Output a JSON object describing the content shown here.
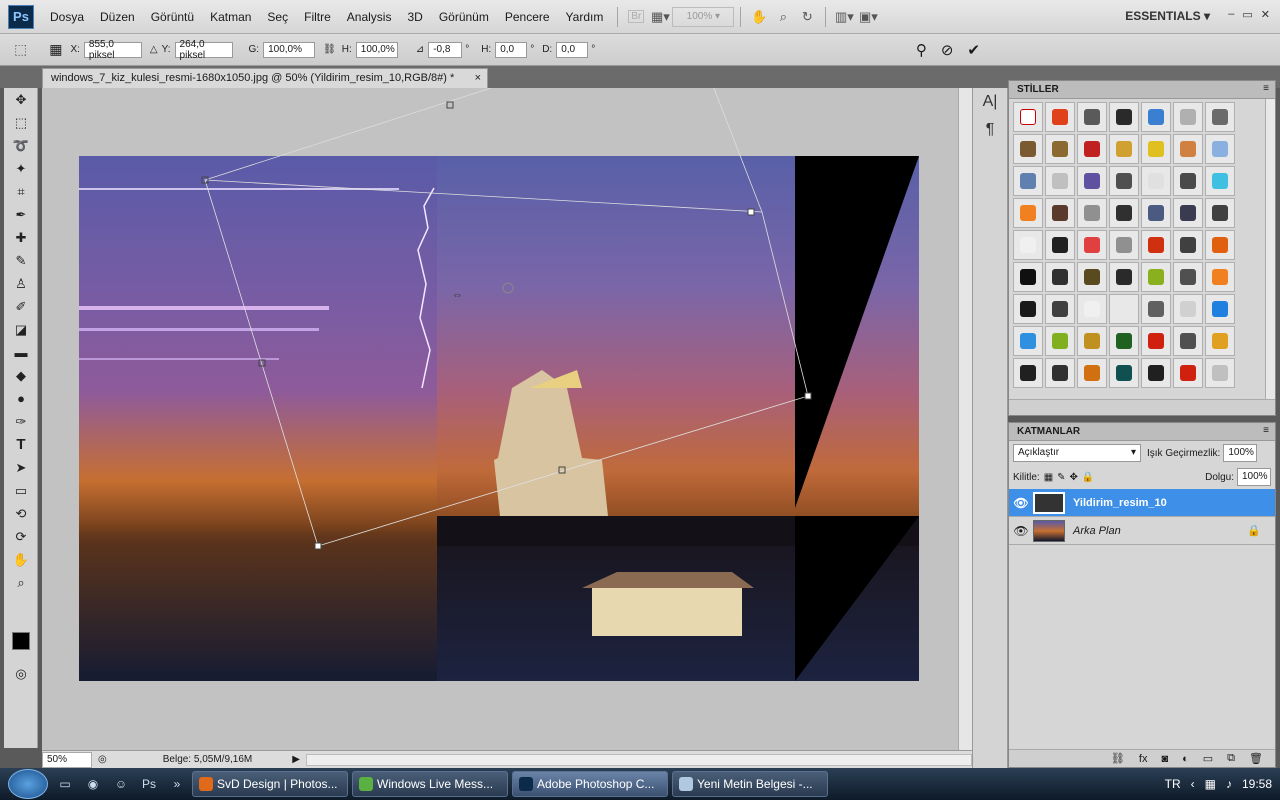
{
  "app": {
    "logo": "Ps",
    "menus": [
      "Dosya",
      "Düzen",
      "Görüntü",
      "Katman",
      "Seç",
      "Filtre",
      "Analysis",
      "3D",
      "Görünüm",
      "Pencere",
      "Yardım"
    ],
    "br_button": "Br",
    "zoom_level": "100%",
    "workspace": "ESSENTIALS",
    "window_controls": [
      "–",
      "▭",
      "✕"
    ]
  },
  "options": {
    "x_label": "X:",
    "x_value": "855,0 piksel",
    "y_label": "Y:",
    "y_value": "264,0 piksel",
    "w_label": "G:",
    "w_value": "100,0%",
    "h_label": "H:",
    "h_value": "100,0%",
    "angle_value": "-0,8",
    "degree": "°",
    "hskew_label": "H:",
    "hskew_value": "0,0",
    "vskew_label": "D:",
    "vskew_value": "0,0"
  },
  "document": {
    "tab_title": "windows_7_kiz_kulesi_resmi-1680x1050.jpg @ 50% (Yildirim_resim_10,RGB/8#) *",
    "close": "×"
  },
  "status": {
    "zoom": "50%",
    "doc_size": "Belge: 5,05M/9,16M"
  },
  "styles_panel": {
    "title": "STİLLER",
    "swatch_colors": [
      "#ffffff",
      "#e0401a",
      "#5a5a5a",
      "#2a2a2a",
      "#3a7fd0",
      "#b0b0b0",
      "#6a6a6a",
      "#7a5a30",
      "#8a6a30",
      "#c02020",
      "#d0a030",
      "#e0c020",
      "#d08040",
      "#8ab0e0",
      "#6080b0",
      "#c0c0c0",
      "#6050a0",
      "#505050",
      "#e0e0e0",
      "#4a4a4a",
      "#40c0e0",
      "#f08020",
      "#5a3a2a",
      "#909090",
      "#303030",
      "#4a5a80",
      "#3a3a50",
      "#404040",
      "#f0f0f0",
      "#202020",
      "#e04040",
      "#909090",
      "#d03010",
      "#404040",
      "#e06010",
      "#101010",
      "#303030",
      "#5a4a20",
      "#2a2a2a",
      "#8ab020",
      "#505050",
      "#f08020",
      "#1a1a1a",
      "#404040",
      "#f0f0f0",
      "#e8e8e8",
      "#606060",
      "#d0d0d0",
      "#2080e0",
      "#3090e0",
      "#80b020",
      "#c09020",
      "#206020",
      "#d02010",
      "#505050",
      "#e0a020",
      "#202020",
      "#303030",
      "#d07010",
      "#105050",
      "#202020",
      "#d02010",
      "#c0c0c0"
    ]
  },
  "layers_panel": {
    "title": "KATMANLAR",
    "blend_mode": "Açıklaştır",
    "opacity_label": "Işık Geçirmezlik:",
    "opacity_value": "100%",
    "lock_label": "Kilitle:",
    "fill_label": "Dolgu:",
    "fill_value": "100%",
    "layers": [
      {
        "name": "Yildirim_resim_10",
        "selected": true
      },
      {
        "name": "Arka Plan",
        "selected": false
      }
    ],
    "lock_icon": "lock-icon"
  },
  "taskbar": {
    "tasks": [
      "SvD Design | Photos...",
      "Windows Live Mess...",
      "Adobe Photoshop C...",
      "Yeni Metin Belgesi -..."
    ],
    "language": "TR",
    "clock": "19:58"
  }
}
